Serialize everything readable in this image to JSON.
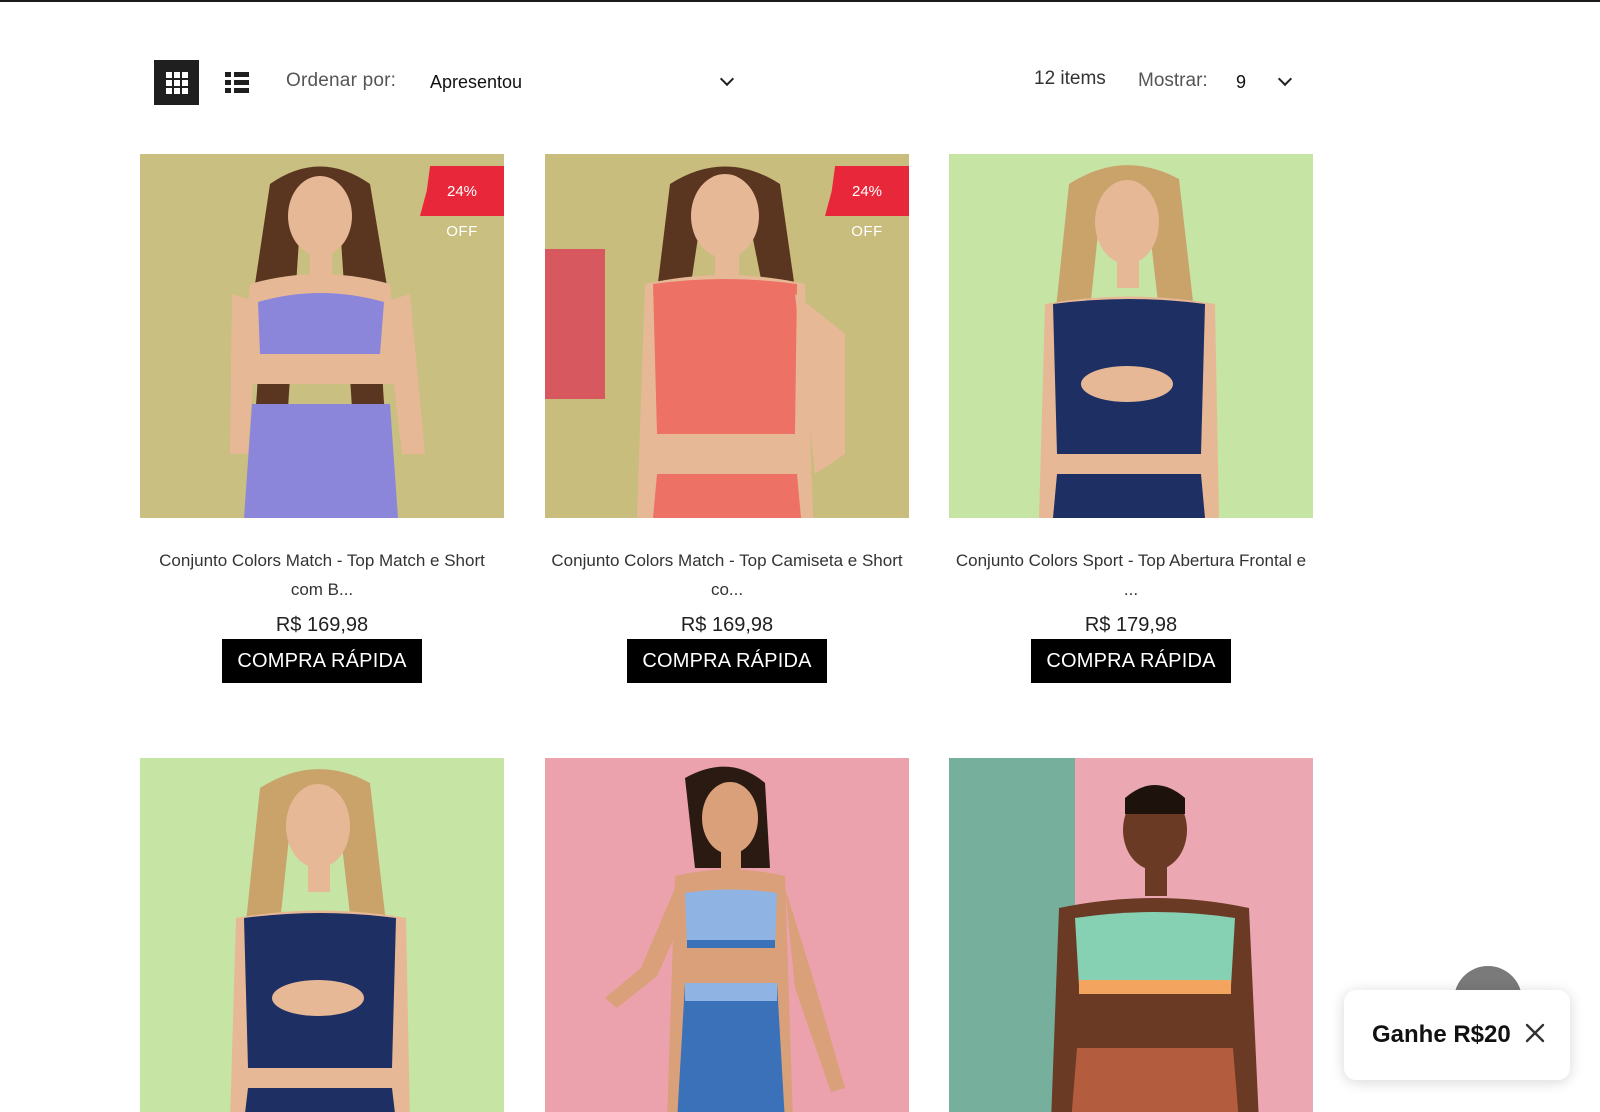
{
  "toolbar": {
    "sort_label": "Ordenar por:",
    "sort_value": "Apresentou",
    "items_count": "12 items",
    "show_label": "Mostrar:",
    "show_value": "9"
  },
  "products": [
    {
      "title": "Conjunto Colors Match - Top Match e Short com B...",
      "price": "R$ 169,98",
      "button": "COMPRA RÁPIDA",
      "discount": "24%",
      "discount_suffix": "OFF",
      "bg_color": "#c8bf80",
      "top_color": "#8c86db",
      "bottom_color": "#8c86db"
    },
    {
      "title": "Conjunto Colors Match - Top Camiseta e Short co...",
      "price": "R$ 169,98",
      "button": "COMPRA RÁPIDA",
      "discount": "24%",
      "discount_suffix": "OFF",
      "bg_color": "#c9bd7e",
      "top_color": "#ee7166",
      "bottom_color": "#ee7166"
    },
    {
      "title": "Conjunto Colors Sport - Top Abertura Frontal e ...",
      "price": "R$ 179,98",
      "button": "COMPRA RÁPIDA",
      "bg_color": "#c6e4a4",
      "top_color": "#1e2f63",
      "bottom_color": "#1e2f63"
    },
    {
      "bg_color": "#c6e4a4",
      "top_color": "#1e2f63",
      "bottom_color": "#1e2f63"
    },
    {
      "bg_color": "#eba2ac",
      "top_color": "#8fb4e4",
      "bottom_color": "#3b71b8"
    },
    {
      "bg_color": "#eba8b2",
      "bg_color_left": "#76b09d",
      "top_color": "#86d1b3",
      "bottom_color": "#b35c3e"
    }
  ],
  "promo": {
    "text": "Ganhe R$20"
  },
  "colors": {
    "badge": "#e8283a",
    "button": "#000000",
    "skin_light": "#e7b896",
    "skin_dark": "#6b3a24",
    "hair_brown": "#5a3520",
    "hair_blonde": "#c9a36a"
  }
}
